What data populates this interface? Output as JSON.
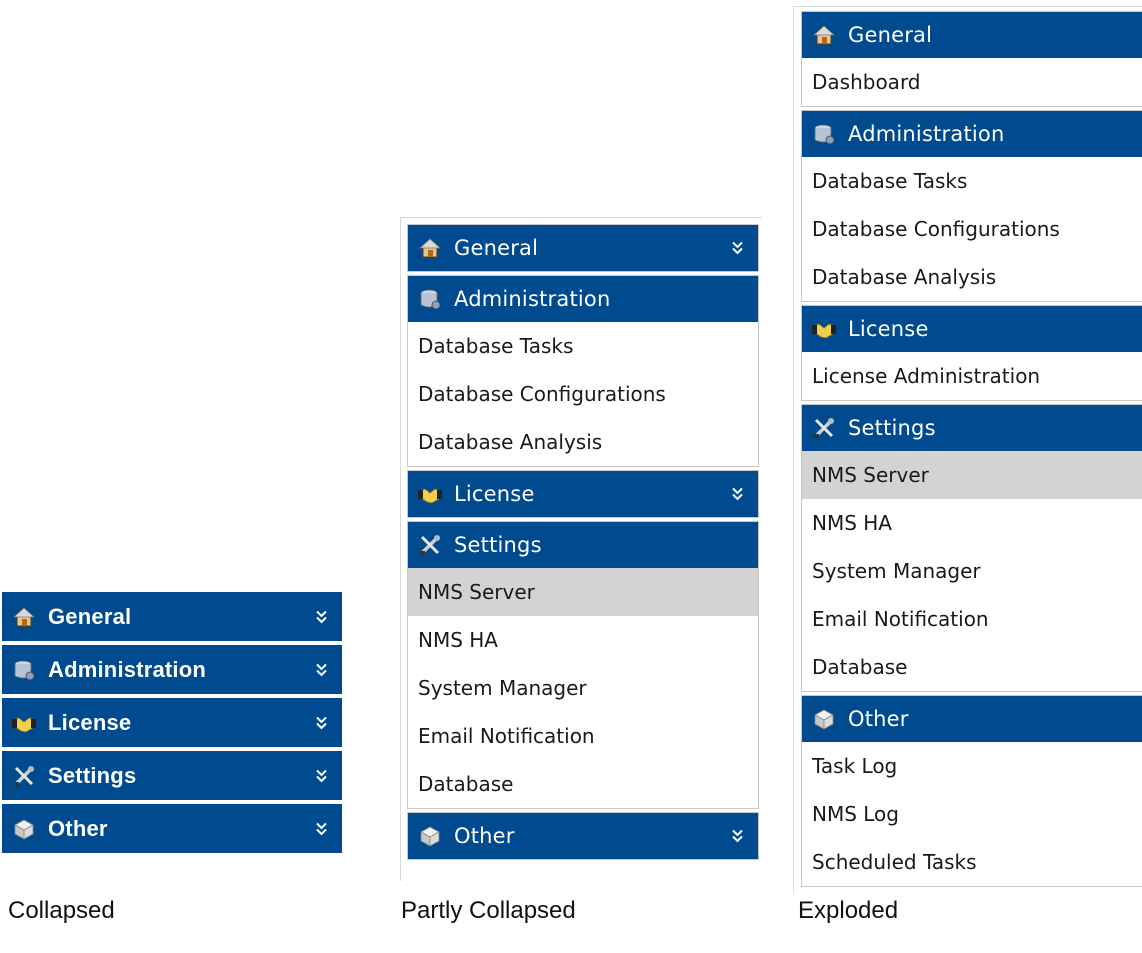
{
  "colors": {
    "header_bg": "#004b8f",
    "header_text": "#ffffff",
    "item_text": "#1a1a1a",
    "active_item_bg": "#d3d3d3"
  },
  "captions": {
    "collapsed": "Collapsed",
    "partly": "Partly Collapsed",
    "exploded": "Exploded"
  },
  "collapsed_panel": {
    "groups": [
      {
        "title": "General",
        "icon": "home-icon",
        "expanded": false
      },
      {
        "title": "Administration",
        "icon": "database-admin-icon",
        "expanded": false
      },
      {
        "title": "License",
        "icon": "handshake-icon",
        "expanded": false
      },
      {
        "title": "Settings",
        "icon": "tools-icon",
        "expanded": false
      },
      {
        "title": "Other",
        "icon": "cube-icon",
        "expanded": false
      }
    ]
  },
  "partly_panel": {
    "groups": [
      {
        "title": "General",
        "icon": "home-icon",
        "expanded": false
      },
      {
        "title": "Administration",
        "icon": "database-admin-icon",
        "expanded": true,
        "items": [
          "Database Tasks",
          "Database Configurations",
          "Database Analysis"
        ]
      },
      {
        "title": "License",
        "icon": "handshake-icon",
        "expanded": false
      },
      {
        "title": "Settings",
        "icon": "tools-icon",
        "expanded": true,
        "items": [
          "NMS Server",
          "NMS HA",
          "System Manager",
          "Email Notification",
          "Database"
        ],
        "active_item": "NMS Server"
      },
      {
        "title": "Other",
        "icon": "cube-icon",
        "expanded": false
      }
    ]
  },
  "exploded_panel": {
    "groups": [
      {
        "title": "General",
        "icon": "home-icon",
        "expanded": true,
        "items": [
          "Dashboard"
        ]
      },
      {
        "title": "Administration",
        "icon": "database-admin-icon",
        "expanded": true,
        "items": [
          "Database Tasks",
          "Database Configurations",
          "Database Analysis"
        ]
      },
      {
        "title": "License",
        "icon": "handshake-icon",
        "expanded": true,
        "items": [
          "License Administration"
        ]
      },
      {
        "title": "Settings",
        "icon": "tools-icon",
        "expanded": true,
        "items": [
          "NMS Server",
          "NMS HA",
          "System Manager",
          "Email Notification",
          "Database"
        ],
        "active_item": "NMS Server"
      },
      {
        "title": "Other",
        "icon": "cube-icon",
        "expanded": true,
        "items": [
          "Task Log",
          "NMS Log",
          "Scheduled Tasks"
        ]
      }
    ]
  }
}
